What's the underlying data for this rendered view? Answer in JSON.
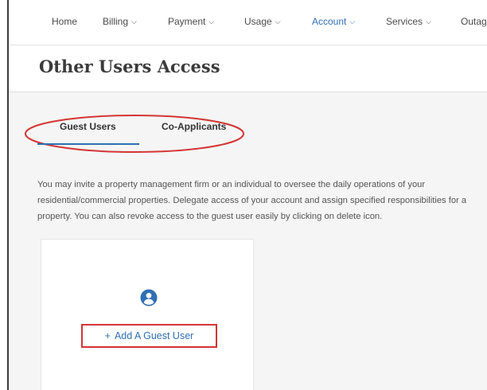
{
  "nav": {
    "items": [
      {
        "label": "Home",
        "has_dropdown": false
      },
      {
        "label": "Billing",
        "has_dropdown": true
      },
      {
        "label": "Payment",
        "has_dropdown": true
      },
      {
        "label": "Usage",
        "has_dropdown": true
      },
      {
        "label": "Account",
        "has_dropdown": true,
        "active": true
      },
      {
        "label": "Services",
        "has_dropdown": true
      },
      {
        "label": "Outag",
        "has_dropdown": false
      }
    ],
    "chevron_icon": "chevron-down-icon",
    "active_color": "#2f6fb3"
  },
  "page": {
    "title": "Other Users Access"
  },
  "tabs": [
    {
      "label": "Guest Users",
      "selected": true
    },
    {
      "label": "Co-Applicants",
      "selected": false
    }
  ],
  "description": "You may invite a property management firm or an individual to oversee the daily operations of your residential/commercial properties. Delegate access of your account and assign specified responsibilities for a property. You can also revoke access to the guest user easily by clicking on delete icon.",
  "card": {
    "icon": "user-circle-icon",
    "add_button_plus": "+",
    "add_button_label": "Add A Guest User"
  },
  "colors": {
    "accent": "#2f6fb3",
    "annotation_red": "#d33535"
  }
}
